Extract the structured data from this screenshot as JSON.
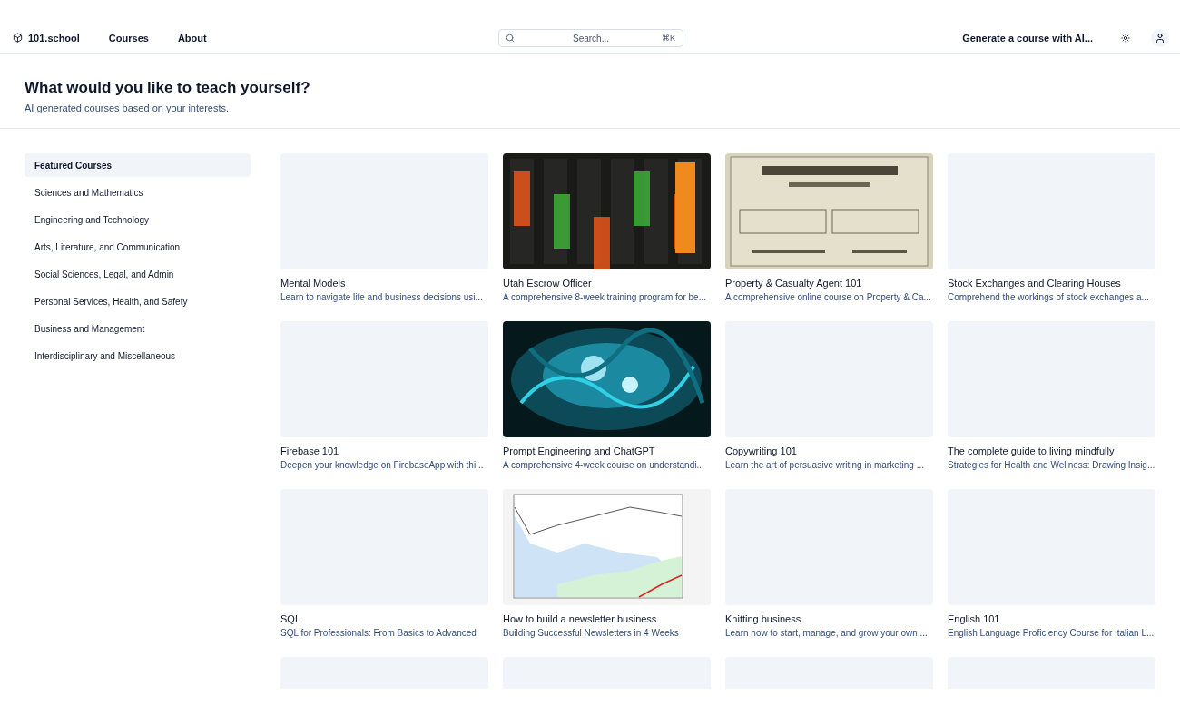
{
  "header": {
    "logo": "101.school",
    "nav": [
      {
        "label": "Courses"
      },
      {
        "label": "About"
      }
    ],
    "search": {
      "placeholder": "Search...",
      "shortcut": "⌘K"
    },
    "generate": "Generate a course with AI..."
  },
  "hero": {
    "title": "What would you like to teach yourself?",
    "subtitle": "AI generated courses based on your interests."
  },
  "sidebar": {
    "items": [
      {
        "label": "Featured Courses",
        "selected": true
      },
      {
        "label": "Sciences and Mathematics",
        "selected": false
      },
      {
        "label": "Engineering and Technology",
        "selected": false
      },
      {
        "label": "Arts, Literature, and Communication",
        "selected": false
      },
      {
        "label": "Social Sciences, Legal, and Admin",
        "selected": false
      },
      {
        "label": "Personal Services, Health, and Safety",
        "selected": false
      },
      {
        "label": "Business and Management",
        "selected": false
      },
      {
        "label": "Interdisciplinary and Miscellaneous",
        "selected": false
      }
    ]
  },
  "courses": [
    {
      "kind": "empty",
      "title": "Mental Models",
      "description": "Learn to navigate life and business decisions usi..."
    },
    {
      "kind": "picture",
      "title": "Utah Escrow Officer",
      "description": "A comprehensive 8-week training program for be..."
    },
    {
      "kind": "picture",
      "title": "Property & Casualty Agent 101",
      "description": "A comprehensive online course on Property & Ca..."
    },
    {
      "kind": "empty",
      "title": "Stock Exchanges and Clearing Houses",
      "description": "Comprehend the workings of stock exchanges a..."
    },
    {
      "kind": "empty",
      "title": "Firebase 101",
      "description": "Deepen your knowledge on FirebaseApp with thi..."
    },
    {
      "kind": "picture",
      "title": "Prompt Engineering and ChatGPT",
      "description": "A comprehensive 4-week course on understandi..."
    },
    {
      "kind": "empty",
      "title": "Copywriting 101",
      "description": "Learn the art of persuasive writing in marketing ..."
    },
    {
      "kind": "empty",
      "title": "The complete guide to living mindfully",
      "description": "Strategies for Health and Wellness: Drawing Insig..."
    },
    {
      "kind": "empty",
      "title": "SQL",
      "description": "SQL for Professionals: From Basics to Advanced"
    },
    {
      "kind": "picture",
      "title": "How to build a newsletter business",
      "description": "Building Successful Newsletters in 4 Weeks"
    },
    {
      "kind": "empty",
      "title": "Knitting business",
      "description": "Learn how to start, manage, and grow your own ..."
    },
    {
      "kind": "empty",
      "title": "English 101",
      "description": "English Language Proficiency Course for Italian L..."
    },
    {
      "kind": "empty"
    },
    {
      "kind": "empty"
    },
    {
      "kind": "empty"
    },
    {
      "kind": "empty"
    }
  ]
}
